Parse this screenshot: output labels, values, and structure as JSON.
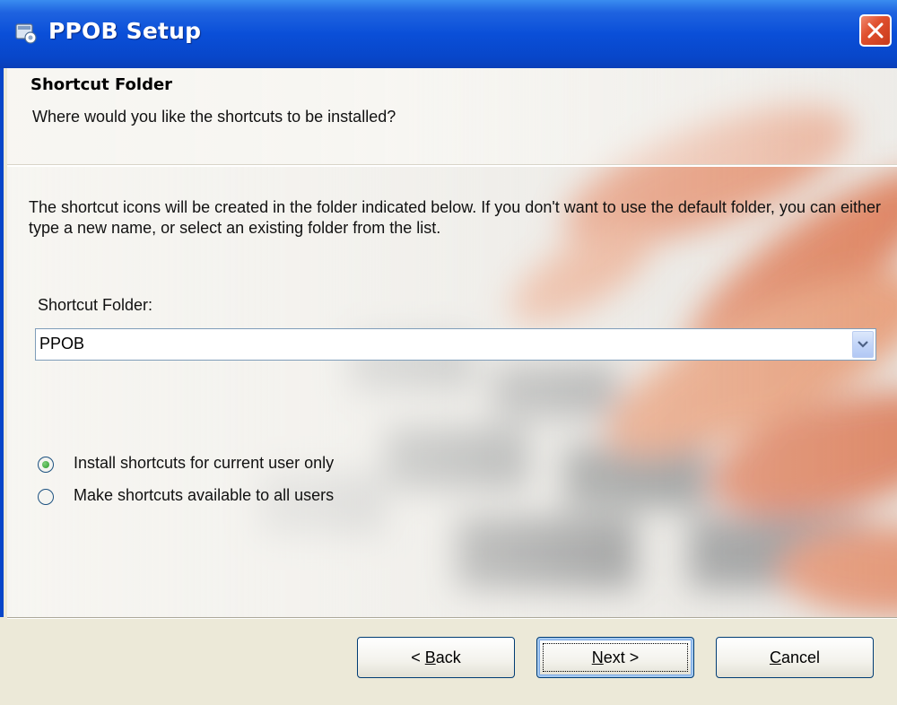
{
  "window": {
    "title": "PPOB Setup",
    "title_icon": "setup-installer-icon",
    "close_icon": "close-icon"
  },
  "header": {
    "title": "Shortcut Folder",
    "subtitle": "Where would you like the shortcuts to be installed?"
  },
  "body": {
    "description": "The shortcut icons will be created in the folder indicated below. If you don't want to use the default folder, you can either type a new name, or select an existing folder from the list.",
    "folder_label": "Shortcut Folder:",
    "folder_value": "PPOB",
    "radio_options": [
      {
        "label": "Install shortcuts for current user only",
        "selected": true
      },
      {
        "label": "Make shortcuts available to all users",
        "selected": false
      }
    ]
  },
  "buttons": {
    "back_prefix": "< ",
    "back_mnemonic": "B",
    "back_rest": "ack",
    "next_mnemonic": "N",
    "next_rest": "ext >",
    "cancel_mnemonic": "C",
    "cancel_rest": "ancel"
  },
  "colors": {
    "title_bar": "#0a4fd8",
    "close_button": "#e0502e",
    "dialog_face": "#ece9d8",
    "radio_selected": "#2c9a28"
  }
}
